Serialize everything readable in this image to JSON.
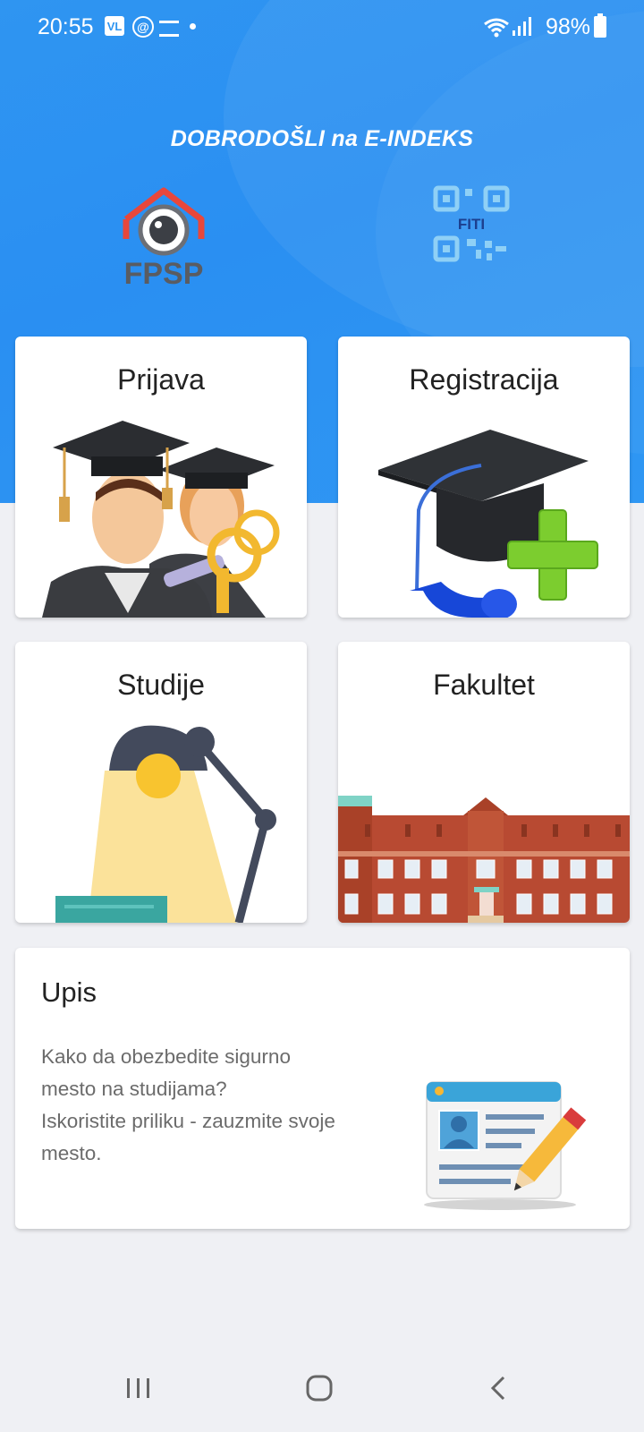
{
  "status_bar": {
    "time": "20:55",
    "notification_icons": [
      "vl-icon",
      "at-icon",
      "message-icon",
      "dot-icon"
    ],
    "icons": [
      "wifi-icon",
      "signal-icon",
      "battery-icon"
    ],
    "battery": "98%"
  },
  "header": {
    "welcome": "DOBRODOŠLI na E-INDEKS",
    "logo_left": "FPSP",
    "logo_right": "FITI"
  },
  "cards": {
    "prijava": "Prijava",
    "registracija": "Registracija",
    "studije": "Studije",
    "fakultet": "Fakultet"
  },
  "upis": {
    "title": "Upis",
    "line1": "Kako da obezbedite sigurno",
    "line2": "mesto na studijama?",
    "line3": "Iskoristite priliku - zauzmite svoje",
    "line4": "mesto."
  },
  "navbar": {
    "icons": [
      "recent-apps-icon",
      "home-icon",
      "back-icon"
    ]
  },
  "colors": {
    "primary_blue": "#2f95f1",
    "background": "#eff0f4",
    "card": "#ffffff",
    "title_text": "#222222",
    "body_text": "#6b6b6b"
  }
}
